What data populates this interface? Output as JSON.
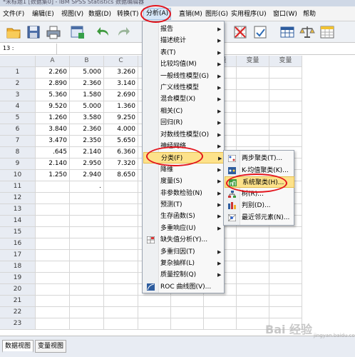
{
  "window": {
    "title": "*未标题1 [数据集0] - IBM SPSS Statistics 数据编辑器"
  },
  "menubar": {
    "items": [
      "文件(F)",
      "编辑(E)",
      "视图(V)",
      "数据(D)",
      "转换(T)",
      "分析(A)",
      "直销(M)",
      "图形(G)",
      "实用程序(U)",
      "窗口(W)",
      "帮助"
    ]
  },
  "cell_ref": "13 :",
  "grid": {
    "columns": [
      "A",
      "B",
      "C",
      "变量",
      "变量",
      "变量",
      "变量",
      "变量"
    ],
    "rows": [
      [
        "1",
        "2.260",
        "5.000",
        "3.260"
      ],
      [
        "2",
        "2.890",
        "2.360",
        "3.140"
      ],
      [
        "3",
        "5.360",
        "1.580",
        "2.690"
      ],
      [
        "4",
        "9.520",
        "5.000",
        "1.360"
      ],
      [
        "5",
        "1.260",
        "3.580",
        "9.250"
      ],
      [
        "6",
        "3.840",
        "2.360",
        "4.000"
      ],
      [
        "7",
        "3.470",
        "2.350",
        "5.650"
      ],
      [
        "8",
        ".645",
        "2.140",
        "6.360"
      ],
      [
        "9",
        "2.140",
        "2.950",
        "7.320"
      ],
      [
        "10",
        "1.250",
        "2.940",
        "8.650"
      ],
      [
        "11",
        "",
        ".",
        ""
      ],
      [
        "12",
        "",
        "",
        ""
      ],
      [
        "13",
        "",
        "",
        ""
      ],
      [
        "14",
        "",
        "",
        ""
      ],
      [
        "15",
        "",
        "",
        ""
      ],
      [
        "16",
        "",
        "",
        ""
      ],
      [
        "17",
        "",
        "",
        ""
      ],
      [
        "18",
        "",
        "",
        ""
      ],
      [
        "19",
        "",
        "",
        ""
      ],
      [
        "20",
        "",
        "",
        ""
      ],
      [
        "21",
        "",
        "",
        ""
      ],
      [
        "22",
        "",
        "",
        ""
      ],
      [
        "23",
        "",
        "",
        ""
      ]
    ]
  },
  "analyze_menu": {
    "items": [
      {
        "label": "报告",
        "arrow": true
      },
      {
        "label": "描述统计",
        "arrow": true
      },
      {
        "label": "表(T)",
        "arrow": true
      },
      {
        "label": "比较均值(M)",
        "arrow": true
      },
      {
        "label": "一般线性模型(G)",
        "arrow": true
      },
      {
        "label": "广义线性模型",
        "arrow": true
      },
      {
        "label": "混合模型(X)",
        "arrow": true
      },
      {
        "label": "相关(C)",
        "arrow": true
      },
      {
        "label": "回归(R)",
        "arrow": true
      },
      {
        "label": "对数线性模型(O)",
        "arrow": true
      },
      {
        "label": "神经网络",
        "arrow": true
      },
      {
        "label": "分类(F)",
        "arrow": true
      },
      {
        "label": "降维",
        "arrow": true
      },
      {
        "label": "度量(S)",
        "arrow": true
      },
      {
        "label": "非参数检验(N)",
        "arrow": true
      },
      {
        "label": "预测(T)",
        "arrow": true
      },
      {
        "label": "生存函数(S)",
        "arrow": true
      },
      {
        "label": "多重响应(U)",
        "arrow": true
      },
      {
        "label": "缺失值分析(Y)...",
        "arrow": false
      },
      {
        "label": "多重归因(T)",
        "arrow": true
      },
      {
        "label": "复杂抽样(L)",
        "arrow": true
      },
      {
        "label": "质量控制(Q)",
        "arrow": true
      },
      {
        "label": "ROC 曲线图(V)...",
        "arrow": false
      }
    ]
  },
  "classify_menu": {
    "items": [
      "两步聚类(T)...",
      "K-均值聚类(K)...",
      "系统聚类(H)...",
      "树(R)...",
      "判别(D)...",
      "最近邻元素(N)..."
    ]
  },
  "bottom_tabs": [
    "数据视图",
    "变量视图"
  ],
  "watermark": "Bai 经验",
  "watermark_sub": "jingyan.baidu.com",
  "colors": {
    "highlight": "#fde28a",
    "circle": "#e3141c",
    "header": "#e8ecf3"
  }
}
